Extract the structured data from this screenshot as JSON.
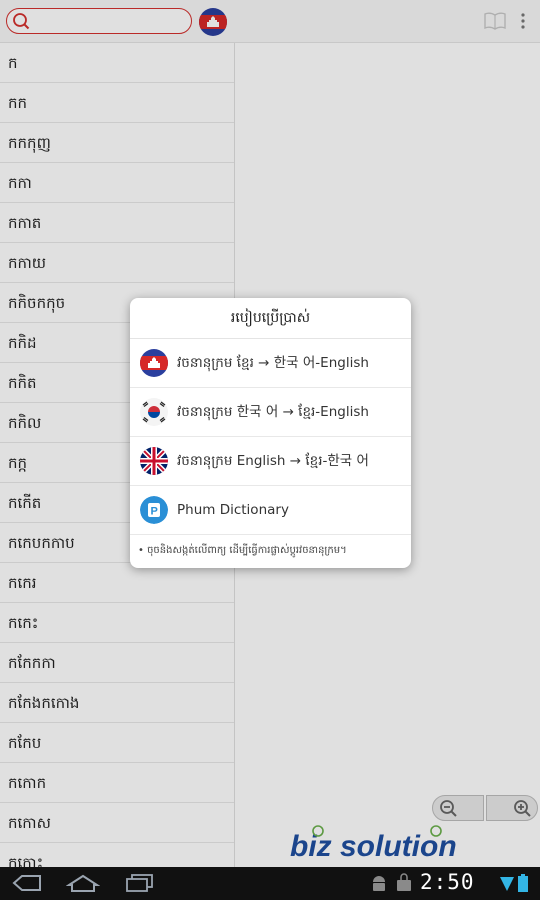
{
  "search": {
    "value": "",
    "placeholder": ""
  },
  "word_list": [
    "ក",
    "កក",
    "កកកុញ",
    "កកា",
    "កកាត",
    "កកាយ",
    "កកិចកកុច",
    "កកិដ",
    "កកិត",
    "កកិល",
    "កក្ក",
    "កកើត",
    "កកេបកកាប",
    "កកេរ",
    "កកេះ",
    "កកែកកា",
    "កកែងកកោង",
    "កកែប",
    "កកោក",
    "កកោស",
    "កកោះ"
  ],
  "dialog": {
    "title": "របៀបប្រើប្រាស់",
    "options": [
      {
        "label": "វចនានុក្រម ខ្មែរ → 한국 어-English",
        "icon": "cambodia-flag-icon"
      },
      {
        "label": "វចនានុក្រម 한국 어 → ខ្មែរ-English",
        "icon": "korea-flag-icon"
      },
      {
        "label": "វចនានុក្រម English → ខ្មែរ-한국 어",
        "icon": "uk-flag-icon"
      },
      {
        "label": "Phum Dictionary",
        "icon": "phum-dictionary-icon"
      }
    ],
    "note": "• ចុចនិងសង្កត់លើពាក្យ ដើម្បីធ្វើការផ្លាស់ប្ដូរវចនានុក្រម។"
  },
  "logo_text": "biz solution",
  "status": {
    "time": "2:50"
  },
  "colors": {
    "accent": "#d4302e",
    "navbar": "#111111",
    "logo": "#1f4fa0"
  }
}
